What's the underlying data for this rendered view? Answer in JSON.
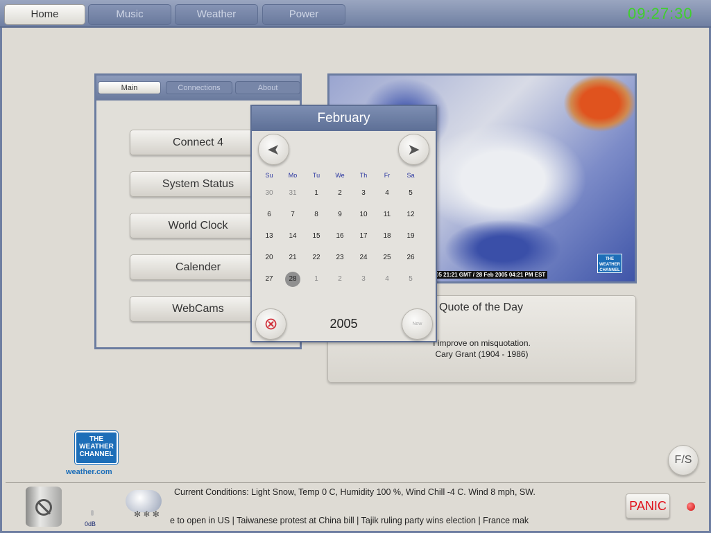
{
  "tabs": [
    {
      "label": "Home"
    },
    {
      "label": "Music"
    },
    {
      "label": "Weather"
    },
    {
      "label": "Power"
    }
  ],
  "clock": "09:27:30",
  "panel": {
    "tabs": [
      "Main",
      "Connections",
      "About"
    ],
    "buttons": [
      "Connect 4",
      "System Status",
      "World Clock",
      "Calender",
      "WebCams"
    ]
  },
  "calendar": {
    "month": "February",
    "year": "2005",
    "now_label": "Now",
    "weekdays": [
      "Su",
      "Mo",
      "Tu",
      "We",
      "Th",
      "Fr",
      "Sa"
    ],
    "weeks": [
      [
        "30",
        "31",
        "1",
        "2",
        "3",
        "4",
        "5"
      ],
      [
        "6",
        "7",
        "8",
        "9",
        "10",
        "11",
        "12"
      ],
      [
        "13",
        "14",
        "15",
        "16",
        "17",
        "18",
        "19"
      ],
      [
        "20",
        "21",
        "22",
        "23",
        "24",
        "25",
        "26"
      ],
      [
        "27",
        "28",
        "1",
        "2",
        "3",
        "4",
        "5"
      ]
    ],
    "selected": "28"
  },
  "map": {
    "timestamp": "05 21:21 GMT / 28 Feb 2005 04:21 PM EST",
    "logo": "THE WEATHER CHANNEL"
  },
  "quote": {
    "title": "Quote of the Day",
    "text": "I improve on misquotation.",
    "author": "Cary Grant (1904 - 1986)"
  },
  "logo": {
    "brand": "THE WEATHER CHANNEL",
    "url": "weather.com"
  },
  "fs_label": "F/S",
  "volume": "0dB",
  "conditions": "Current Conditions: Light Snow, Temp 0 C, Humidity 100 %, Wind Chill -4 C. Wind 8 mph, SW.",
  "ticker": "e to open in US | Taiwanese protest at China bill | Tajik ruling party wins election | France mak",
  "panic_label": "PANIC",
  "colors": {
    "accent": "#6f7fa2",
    "clock": "#3fcf2c",
    "panic": "#e0101a"
  }
}
